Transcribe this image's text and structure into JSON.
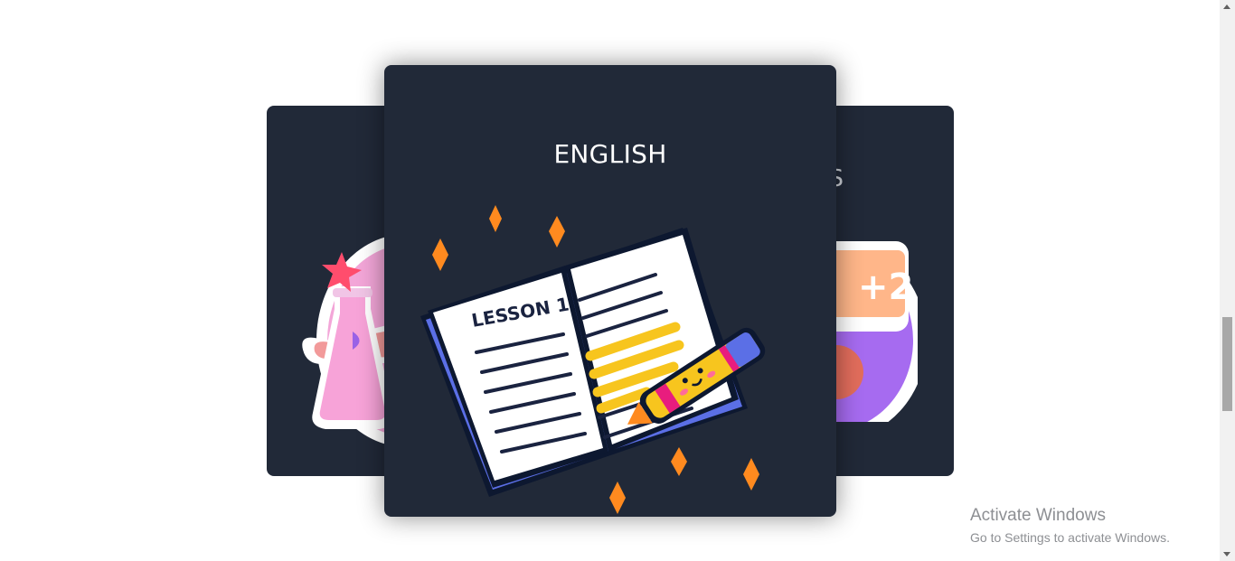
{
  "carousel": {
    "center_card": {
      "title": "ENGLISH",
      "illustration": "lesson-book-icon",
      "book_text": "LESSON 1"
    },
    "right_card": {
      "title_partial": "S",
      "illustration": "math-blackboard-icon",
      "board_text": "+2"
    },
    "left_card": {
      "illustration": "science-flask-icon"
    }
  },
  "watermark": {
    "title": "Activate Windows",
    "subtitle": "Go to Settings to activate Windows."
  },
  "colors": {
    "card_bg": "#212938",
    "page_bg": "#ffffff",
    "accent_orange": "#ff8a1f",
    "highlighter_yellow": "#f7c51e"
  }
}
